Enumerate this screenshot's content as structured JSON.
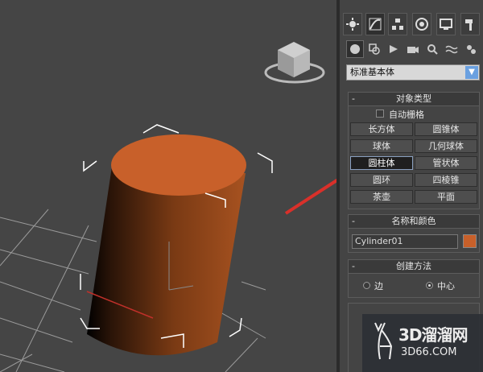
{
  "command_panel": {
    "category": "标准基本体",
    "object_type": {
      "title": "对象类型",
      "autogrid": "自动栅格",
      "buttons": [
        "长方体",
        "圆锥体",
        "球体",
        "几何球体",
        "圆柱体",
        "管状体",
        "圆环",
        "四棱锥",
        "茶壶",
        "平面"
      ],
      "selected": "圆柱体"
    },
    "name_color": {
      "title": "名称和颜色",
      "name_value": "Cylinder01",
      "color": "#c8602a"
    },
    "creation_method": {
      "title": "创建方法",
      "options": [
        "边",
        "中心"
      ],
      "selected": "中心"
    }
  },
  "watermark": {
    "text": "3D溜溜网",
    "sub": "3D66.COM"
  },
  "colors": {
    "annotation_arrow": "#d9302a",
    "object": "#c8602a"
  }
}
